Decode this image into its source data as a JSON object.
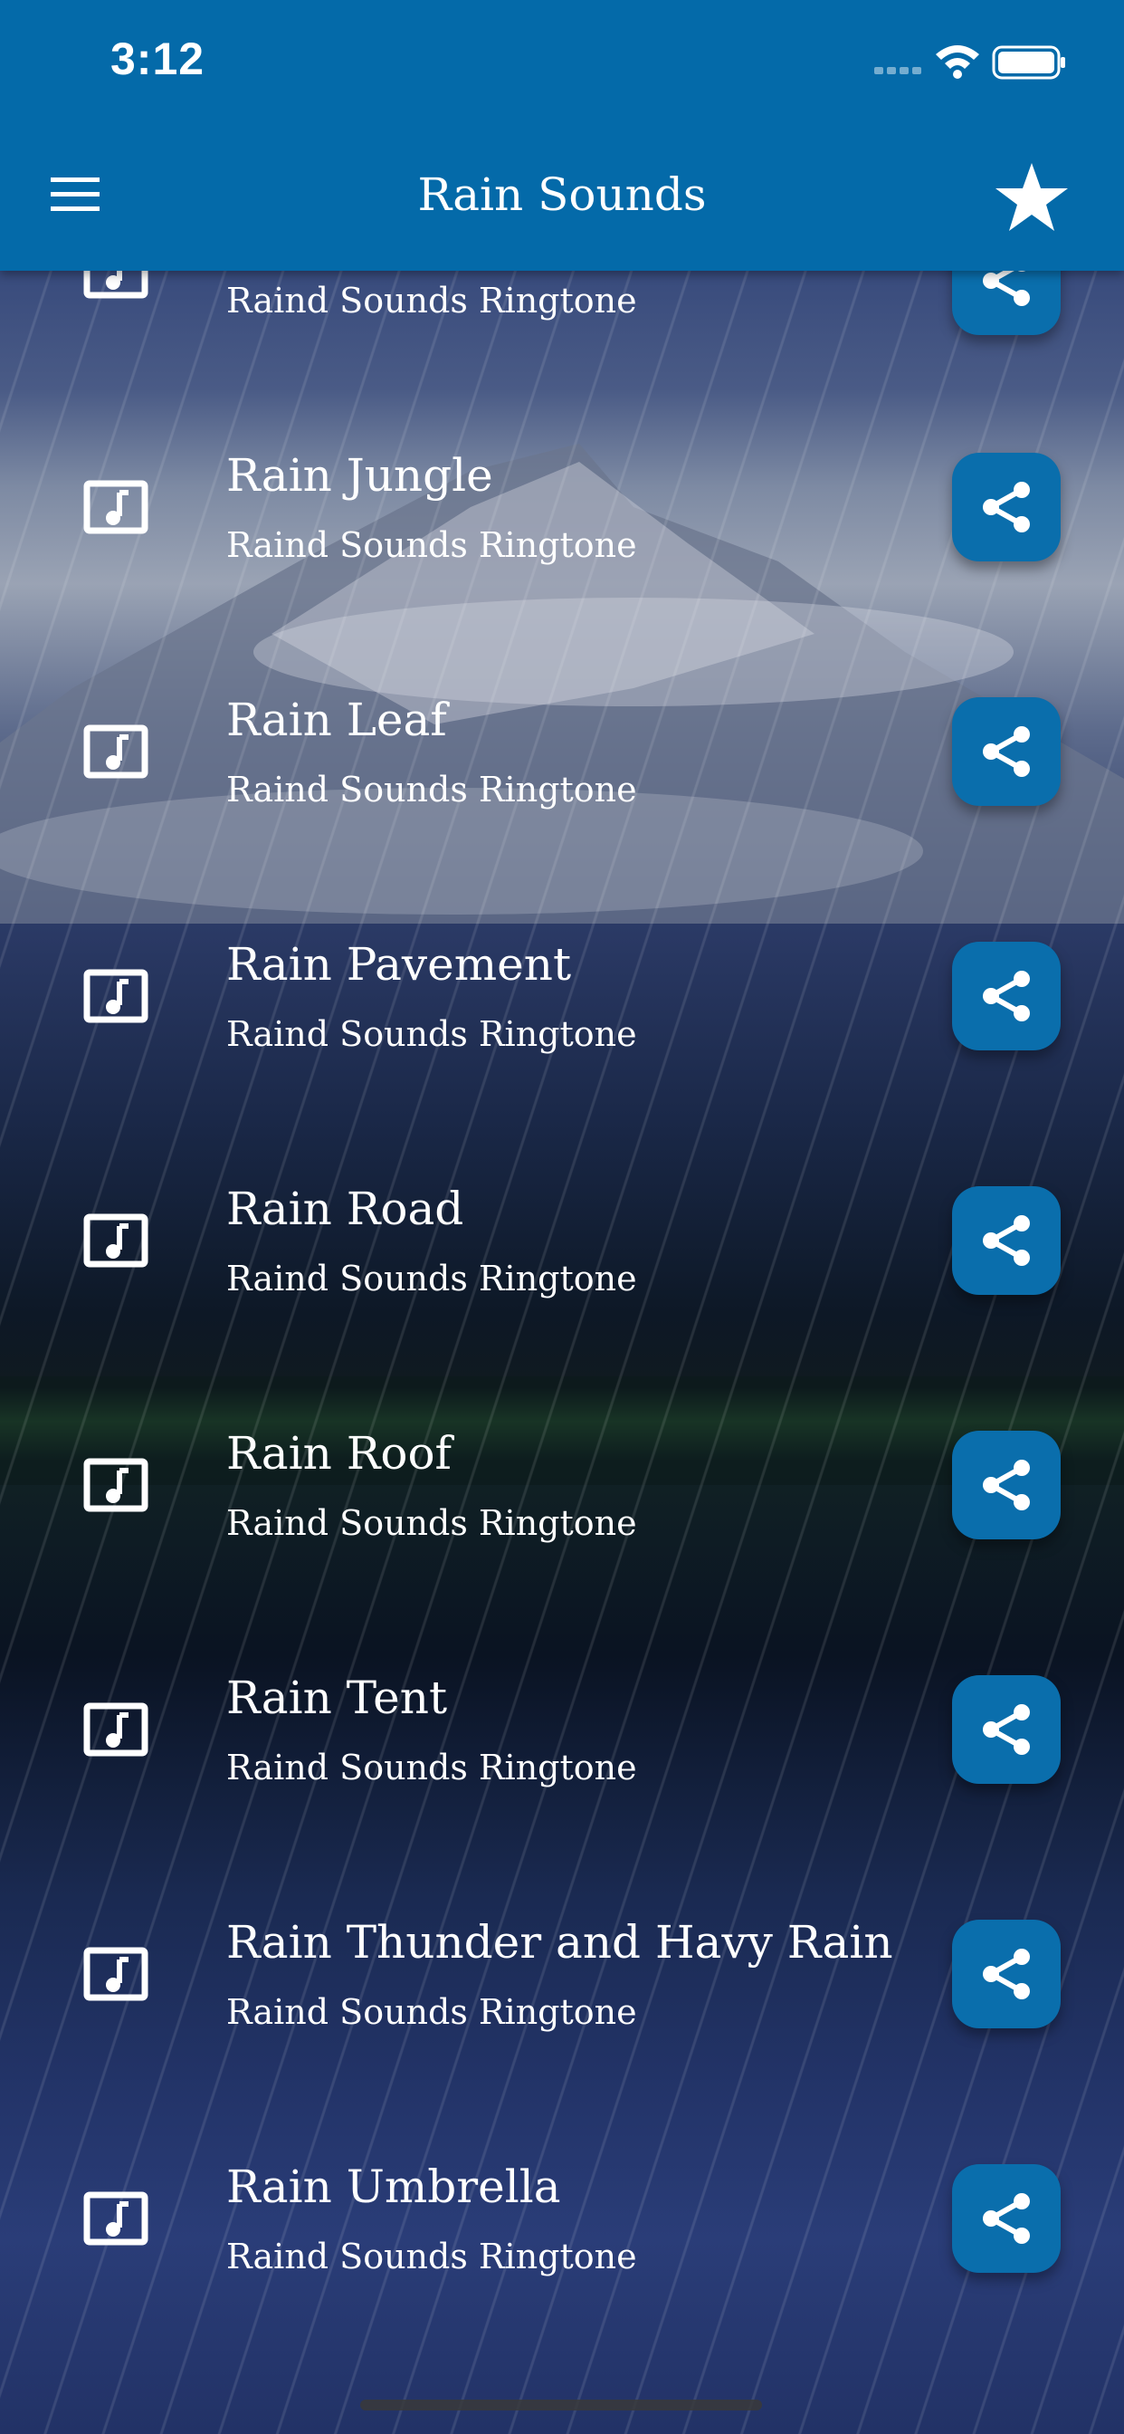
{
  "status_bar": {
    "time": "3:12"
  },
  "header": {
    "title": "Rain Sounds"
  },
  "list": [
    {
      "title": "",
      "subtitle": "Raind Sounds Ringtone"
    },
    {
      "title": "Rain Jungle",
      "subtitle": "Raind Sounds Ringtone"
    },
    {
      "title": "Rain Leaf",
      "subtitle": "Raind Sounds Ringtone"
    },
    {
      "title": "Rain Pavement",
      "subtitle": "Raind Sounds Ringtone"
    },
    {
      "title": "Rain Road",
      "subtitle": "Raind Sounds Ringtone"
    },
    {
      "title": "Rain Roof",
      "subtitle": "Raind Sounds Ringtone"
    },
    {
      "title": "Rain Tent",
      "subtitle": "Raind Sounds Ringtone"
    },
    {
      "title": "Rain Thunder and Havy Rain",
      "subtitle": "Raind Sounds Ringtone"
    },
    {
      "title": "Rain Umbrella",
      "subtitle": "Raind Sounds Ringtone"
    }
  ],
  "icons": {
    "menu": "hamburger-menu-icon",
    "favorite": "star-icon",
    "item": "music-note-icon",
    "share": "share-icon"
  },
  "colors": {
    "header_bg": "#046aa9",
    "share_button": "#0a6eac"
  }
}
